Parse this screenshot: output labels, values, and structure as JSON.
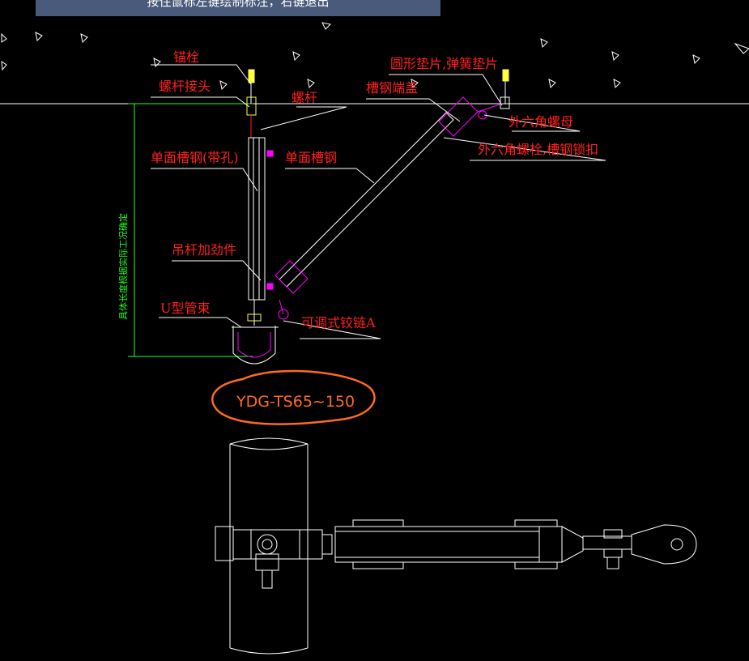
{
  "hint_bar": {
    "text": "按住鼠标左键绘制标注，右键退出"
  },
  "labels": {
    "anchor_bolt": "锚栓",
    "rod_connector": "螺杆接头",
    "threaded_rod": "螺杆",
    "washer": "圆形垫片,弹簧垫片",
    "channel_end_cap": "槽钢端盖",
    "hex_nut": "外六角螺母",
    "single_channel_holes": "单面槽钢(带孔)",
    "single_channel": "单面槽钢",
    "hex_bolt_lock": "外六角螺栓,槽钢锁扣",
    "rod_stiffener": "吊杆加劲件",
    "u_clamp": "U型管束",
    "adjustable_hinge": "可调式铰链A",
    "vertical_note": "具体长度根据实际工况确定"
  },
  "annotation": {
    "model_text": "YDG-TS65~150",
    "color": "#ff6a20"
  },
  "colors": {
    "label": "#ff2020",
    "line": "#ffffff",
    "accent": "#ff00ff",
    "dimension": "#20ff20",
    "bolt": "#ffff40"
  }
}
